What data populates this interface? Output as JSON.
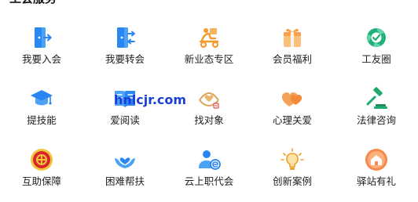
{
  "section": {
    "title": "工会服务"
  },
  "services": [
    {
      "label": "我要入会",
      "icon": "door-enter-icon",
      "color": "#2a86f0"
    },
    {
      "label": "我要转会",
      "icon": "door-transfer-icon",
      "color": "#2a86f0"
    },
    {
      "label": "新业态专区",
      "icon": "delivery-scooter-icon",
      "color": "#f39a2d"
    },
    {
      "label": "会员福利",
      "icon": "gift-box-icon",
      "color": "#f7a04b"
    },
    {
      "label": "工友圈",
      "icon": "circle-community-icon",
      "color": "#21b07a"
    },
    {
      "label": "提技能",
      "icon": "graduation-cap-icon",
      "color": "#2a86f0"
    },
    {
      "label": "爱阅读",
      "icon": "book-icon",
      "color": "#2a86f0"
    },
    {
      "label": "找对象",
      "icon": "matchmaking-icon",
      "color": "#d9a55a"
    },
    {
      "label": "心理关爱",
      "icon": "hearts-icon",
      "color": "#f38a3a"
    },
    {
      "label": "法律咨询",
      "icon": "gavel-icon",
      "color": "#21a96f"
    },
    {
      "label": "互助保障",
      "icon": "union-emblem-icon",
      "color": "#d8262a"
    },
    {
      "label": "困难帮扶",
      "icon": "helping-hands-icon",
      "color": "#2a86f0"
    },
    {
      "label": "云上职代会",
      "icon": "user-e-icon",
      "color": "#2a86f0"
    },
    {
      "label": "创新案例",
      "icon": "lightbulb-icon",
      "color": "#f0a030"
    },
    {
      "label": "驿站有礼",
      "icon": "house-badge-icon",
      "color": "#f58a4a"
    }
  ],
  "watermark": {
    "text": "hnlcjr.com",
    "color": "#1a3fd8"
  }
}
